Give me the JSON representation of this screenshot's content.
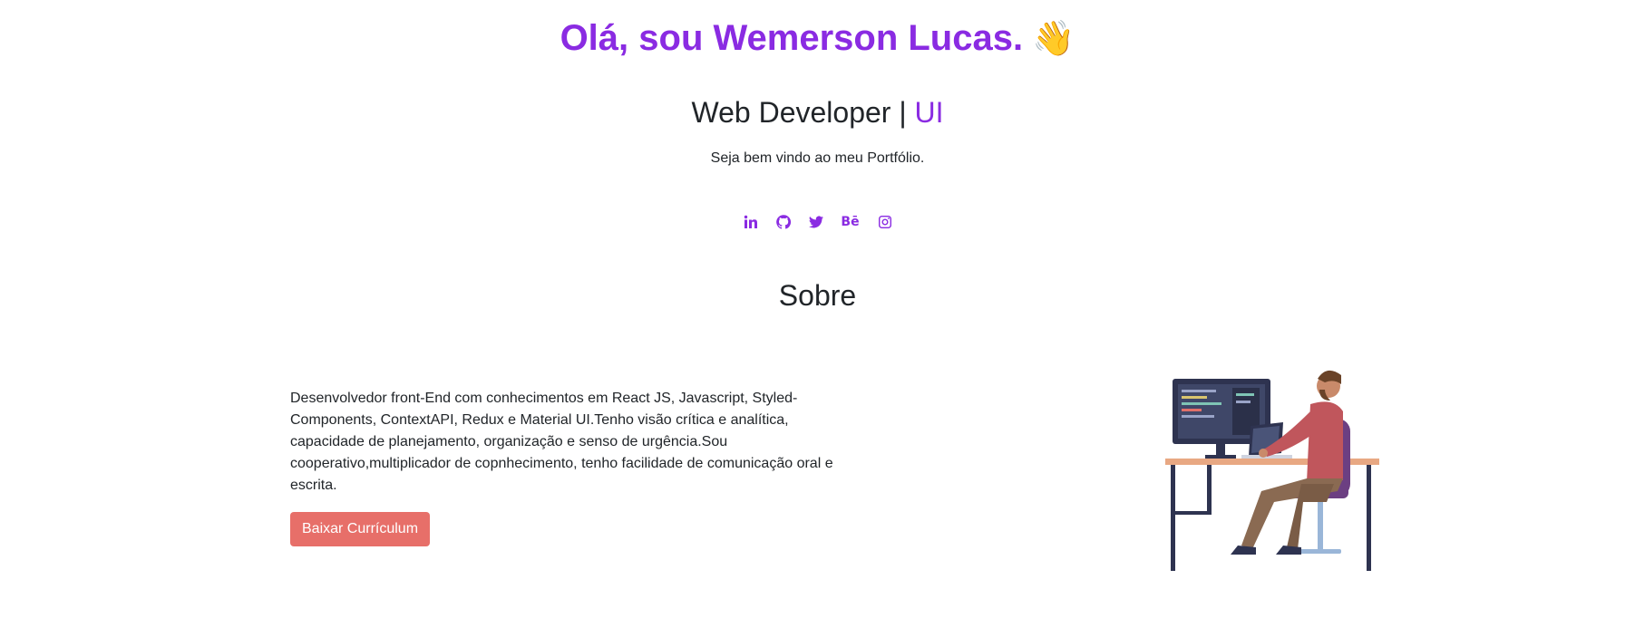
{
  "hero": {
    "greeting": "Olá, sou Wemerson Lucas.",
    "wave_emoji": "👋"
  },
  "subtitle": {
    "role": "Web Developer |",
    "accent": "UI"
  },
  "welcome_text": "Seja bem vindo ao meu Portfólio.",
  "social": {
    "icons": [
      "linkedin-icon",
      "github-icon",
      "twitter-icon",
      "behance-icon",
      "instagram-icon"
    ],
    "behance_glyph": "Bē"
  },
  "about": {
    "title": "Sobre",
    "text": "Desenvolvedor front-End com conhecimentos em React JS, Javascript, Styled-Components, ContextAPI, Redux e Material UI.Tenho visão crítica e analítica, capacidade de planejamento, organização e senso de urgência.Sou cooperativo,multiplicador de copnhecimento, tenho facilidade de comunicação oral e escrita.",
    "button_label": "Baixar Currículum"
  },
  "colors": {
    "accent": "#8a2be2",
    "button": "#e76f69",
    "text": "#212529"
  }
}
